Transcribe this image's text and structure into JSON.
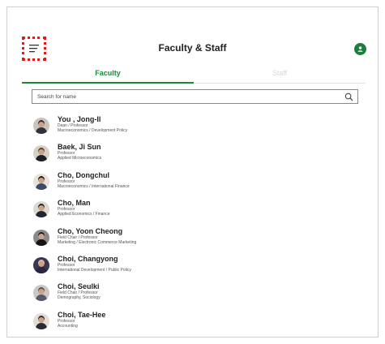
{
  "header": {
    "title": "Faculty & Staff",
    "menu_icon": "hamburger-menu-icon",
    "profile_icon": "user-profile-icon",
    "accent_color": "#1a8a3a"
  },
  "tabs": [
    {
      "label": "Faculty",
      "active": true
    },
    {
      "label": "Staff",
      "active": false
    }
  ],
  "search": {
    "placeholder": "Search for name",
    "icon": "search-icon"
  },
  "faculty": [
    {
      "name": "You , Jong-Il",
      "title": "Dean / Professor",
      "field": "Macroeconomics / Development Policy",
      "avatar": {
        "bg": "#c9c3bb",
        "hair": "#3a2a22",
        "body": "#2f3340"
      }
    },
    {
      "name": "Baek, Ji Sun",
      "title": "Professor",
      "field": "Applied Microeconomics",
      "avatar": {
        "bg": "#d6d0c4",
        "hair": "#5a4030",
        "body": "#1e1e24"
      }
    },
    {
      "name": "Cho, Dongchul",
      "title": "Professor",
      "field": "Macroeconomics / International Finance",
      "avatar": {
        "bg": "#e8e2d8",
        "hair": "#241c18",
        "body": "#3b4a66"
      }
    },
    {
      "name": "Cho, Man",
      "title": "Professor",
      "field": "Applied Economics / Finance",
      "avatar": {
        "bg": "#dcd8d2",
        "hair": "#2c2420",
        "body": "#222630"
      }
    },
    {
      "name": "Cho, Yoon Cheong",
      "title": "Field Chair / Professor",
      "field": "Marketing / Electronic Commerce Marketing",
      "avatar": {
        "bg": "#8a8a8a",
        "hair": "#1c1a1a",
        "body": "#141414"
      }
    },
    {
      "name": "Choi, Changyong",
      "title": "Professor",
      "field": "International Development / Public Policy",
      "avatar": {
        "bg": "#3a3550",
        "hair": "#d9b8a0",
        "body": "#2a2540"
      }
    },
    {
      "name": "Choi, Seulki",
      "title": "Field Chair / Professor",
      "field": "Demography, Sociology",
      "avatar": {
        "bg": "#c8c8c8",
        "hair": "#6a4a3a",
        "body": "#555a66"
      }
    },
    {
      "name": "Choi, Tae-Hee",
      "title": "Professor",
      "field": "Accounting",
      "avatar": {
        "bg": "#e2ddd5",
        "hair": "#3a2a20",
        "body": "#282c36"
      }
    }
  ]
}
